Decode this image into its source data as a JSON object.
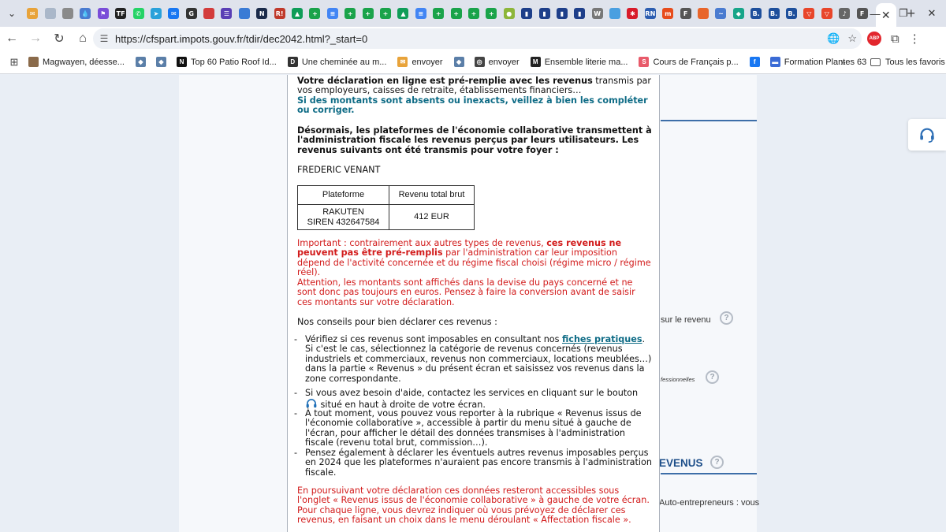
{
  "browser": {
    "url": "https://cfspart.impots.gouv.fr/tdir/dec2042.html?_start=0",
    "tab_close_glyph": "✕",
    "new_tab_glyph": "+",
    "favicons": [
      {
        "c": "#e8a33a",
        "g": "✉"
      },
      {
        "c": "#aab7c9",
        "g": ""
      },
      {
        "c": "#8a8a8a",
        "g": ""
      },
      {
        "c": "#4a7bd0",
        "g": "💧"
      },
      {
        "c": "#7a4dd8",
        "g": "⚑"
      },
      {
        "c": "#222222",
        "g": "TF"
      },
      {
        "c": "#25d366",
        "g": "✆"
      },
      {
        "c": "#2aa1da",
        "g": "➤"
      },
      {
        "c": "#1877f2",
        "g": "✉"
      },
      {
        "c": "#333333",
        "g": "G"
      },
      {
        "c": "#d33b3b",
        "g": ""
      },
      {
        "c": "#5a3fb5",
        "g": "☰"
      },
      {
        "c": "#3a7bd5",
        "g": ""
      },
      {
        "c": "#1b2b4a",
        "g": "N"
      },
      {
        "c": "#c0392b",
        "g": "R!"
      },
      {
        "c": "#0f9d58",
        "g": "▲"
      },
      {
        "c": "#1aa34a",
        "g": "+"
      },
      {
        "c": "#4285f4",
        "g": "≡"
      },
      {
        "c": "#1aa34a",
        "g": "+"
      },
      {
        "c": "#1aa34a",
        "g": "+"
      },
      {
        "c": "#1aa34a",
        "g": "+"
      },
      {
        "c": "#0f9d58",
        "g": "▲"
      },
      {
        "c": "#4285f4",
        "g": "≡"
      },
      {
        "c": "#1aa34a",
        "g": "+"
      },
      {
        "c": "#1aa34a",
        "g": "+"
      },
      {
        "c": "#1aa34a",
        "g": "+"
      },
      {
        "c": "#1aa34a",
        "g": "+"
      },
      {
        "c": "#8db63a",
        "g": "●"
      },
      {
        "c": "#1e3f8a",
        "g": "▮"
      },
      {
        "c": "#1e3f8a",
        "g": "▮"
      },
      {
        "c": "#1e3f8a",
        "g": "▮"
      },
      {
        "c": "#1e3f8a",
        "g": "▮"
      },
      {
        "c": "#777777",
        "g": "W"
      },
      {
        "c": "#4a9fe0",
        "g": ""
      },
      {
        "c": "#d81b2a",
        "g": "✱"
      },
      {
        "c": "#2c5db0",
        "g": "RN"
      },
      {
        "c": "#e74c1c",
        "g": "m"
      },
      {
        "c": "#555555",
        "g": "F"
      },
      {
        "c": "#e8652a",
        "g": ""
      },
      {
        "c": "#4a7bd0",
        "g": "~"
      },
      {
        "c": "#17a589",
        "g": "◆"
      },
      {
        "c": "#1e4f9c",
        "g": "B."
      },
      {
        "c": "#1e4f9c",
        "g": "B."
      },
      {
        "c": "#1e4f9c",
        "g": "B."
      },
      {
        "c": "#e8452a",
        "g": "▽"
      },
      {
        "c": "#e8452a",
        "g": "▽"
      },
      {
        "c": "#666666",
        "g": "♪"
      },
      {
        "c": "#555555",
        "g": "F"
      }
    ],
    "bookmarks": [
      {
        "label": "Magwayen, déesse...",
        "icon": "#8a6a4a",
        "g": ""
      },
      {
        "label": "",
        "icon": "#5b7fa8",
        "g": "◆"
      },
      {
        "label": "",
        "icon": "#5b7fa8",
        "g": "◆"
      },
      {
        "label": "Top 60 Patio Roof Id...",
        "icon": "#111111",
        "g": "N"
      },
      {
        "label": "Une cheminée au m...",
        "icon": "#333333",
        "g": "D"
      },
      {
        "label": "envoyer",
        "icon": "#e8a33a",
        "g": "✉"
      },
      {
        "label": "",
        "icon": "#5b7fa8",
        "g": "◆"
      },
      {
        "label": "envoyer",
        "icon": "#444444",
        "g": "◎"
      },
      {
        "label": "Ensemble literie ma...",
        "icon": "#222222",
        "g": "M"
      },
      {
        "label": "Cours de Français p...",
        "icon": "#e85a6a",
        "g": "S"
      },
      {
        "label": "",
        "icon": "#1877f2",
        "g": "f"
      },
      {
        "label": "Formation Plantes 63",
        "icon": "#3a6bd5",
        "g": "▬"
      }
    ],
    "bookmarks_more": "»",
    "all_bookmarks": "Tous les favoris"
  },
  "background": {
    "row1": "sur le revenu",
    "row2": "fessionnelles",
    "heading": "EVENUS",
    "row3": "Auto-entrepreneurs : vous"
  },
  "modal": {
    "p1_bold": "Votre déclaration en ligne est pré-remplie avec les revenus",
    "p1_rest": " transmis par vos employeurs, caisses de retraite, établissements financiers…",
    "p2": "Si des montants sont absents ou inexacts, veillez à bien les compléter ou corriger.",
    "p3": "Désormais, les plateformes de l'économie collaborative transmettent à l'administration fiscale les revenus perçus par leurs utilisateurs. Les revenus suivants ont été transmis pour votre foyer :",
    "foyer_name": "FREDERIC VENANT",
    "table": {
      "col1": "Plateforme",
      "col2": "Revenu total brut",
      "platform_name": "RAKUTEN",
      "platform_siren": "SIREN 432647584",
      "amount": "412 EUR"
    },
    "important_a": "Important : contrairement aux autres types de revenus, ",
    "important_b": "ces revenus ne peuvent pas être pré-remplis",
    "important_c": " par l'administration car leur imposition dépend de l'activité concernée et du régime fiscal choisi (régime micro / régime réel).",
    "attention": "Attention, les montants sont affichés dans la devise du pays concerné et ne sont donc pas toujours en euros. Pensez à faire la conversion avant de saisir ces montants sur votre déclaration.",
    "conseils": "Nos conseils pour bien déclarer ces revenus :",
    "dash": "-",
    "b1_a": "Vérifiez si ces revenus sont imposables en consultant nos ",
    "b1_link": "fiches pratiques",
    "b1_b": ". Si c'est le cas, sélectionnez la catégorie de revenus concernés (revenus industriels et commerciaux, revenus non commerciaux, locations meublées…) dans la partie « Revenus » du présent écran et saisissez vos revenus dans la zone correspondante.",
    "b2_a": "Si vous avez besoin d'aide, contactez les services en cliquant sur le bouton ",
    "b2_b": " situé en haut à droite de votre écran.",
    "b3": "À tout moment, vous pouvez vous reporter à la rubrique « Revenus issus de l'économie collaborative », accessible à partir du menu situé à gauche de l'écran, pour afficher le détail des données transmises à l'administration fiscale (revenu total brut, commission…).",
    "b4": "Pensez également à déclarer les éventuels autres revenus imposables perçus en 2024 que les plateformes n'auraient pas encore transmis à l'administration fiscale.",
    "final": "En poursuivant votre déclaration ces données resteront accessibles sous l'onglet « Revenus issus de l'économie collaborative » à gauche de votre écran. Pour chaque ligne, vous devrez indiquer où vous prévoyez de déclarer ces revenus, en faisant un choix dans le menu déroulant « Affectation fiscale »."
  },
  "colors": {
    "teal": "#0f6c86",
    "red": "#d21b1b",
    "accent_blue": "#3d6ea8"
  }
}
